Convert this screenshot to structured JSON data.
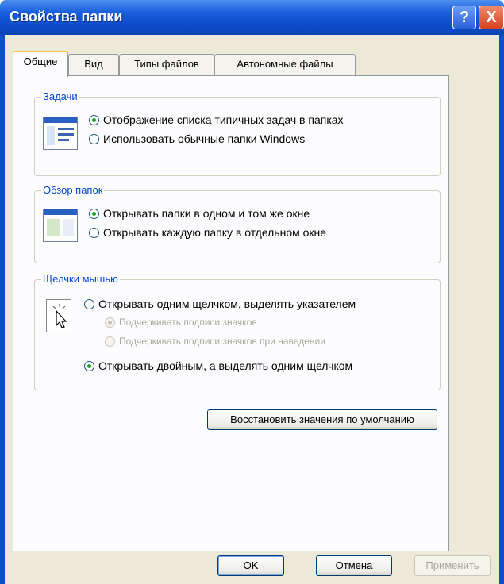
{
  "window": {
    "title": "Свойства папки",
    "help_glyph": "?",
    "close_glyph": "X"
  },
  "tabs": [
    {
      "label": "Общие",
      "active": true
    },
    {
      "label": "Вид",
      "active": false
    },
    {
      "label": "Типы файлов",
      "active": false
    },
    {
      "label": "Автономные файлы",
      "active": false
    }
  ],
  "groups": {
    "tasks": {
      "label": "Задачи",
      "icon": "tasks-folder-icon",
      "options": [
        {
          "label": "Отображение списка типичных задач в папках",
          "selected": true
        },
        {
          "label": "Использовать обычные папки Windows",
          "selected": false
        }
      ]
    },
    "browse": {
      "label": "Обзор папок",
      "icon": "browse-window-icon",
      "options": [
        {
          "label": "Открывать папки в одном и том же окне",
          "selected": true
        },
        {
          "label": "Открывать каждую папку в отдельном окне",
          "selected": false
        }
      ]
    },
    "clicks": {
      "label": "Щелчки мышью",
      "icon": "mouse-click-icon",
      "options": [
        {
          "label": "Открывать одним щелчком, выделять указателем",
          "selected": false
        },
        {
          "label": "Подчеркивать подписи значков",
          "selected": true,
          "disabled": true
        },
        {
          "label": "Подчеркивать подписи значков при наведении",
          "selected": false,
          "disabled": true
        },
        {
          "label": "Открывать двойным, а выделять одним щелчком",
          "selected": true
        }
      ]
    }
  },
  "restore_button": "Восстановить значения по умолчанию",
  "buttons": {
    "ok": "OK",
    "cancel": "Отмена",
    "apply": "Применить"
  },
  "colors": {
    "title_bar": "#0a50c8",
    "dialog_face": "#ece9d8",
    "group_label": "#0046d5",
    "radio_dot": "#21a121"
  }
}
